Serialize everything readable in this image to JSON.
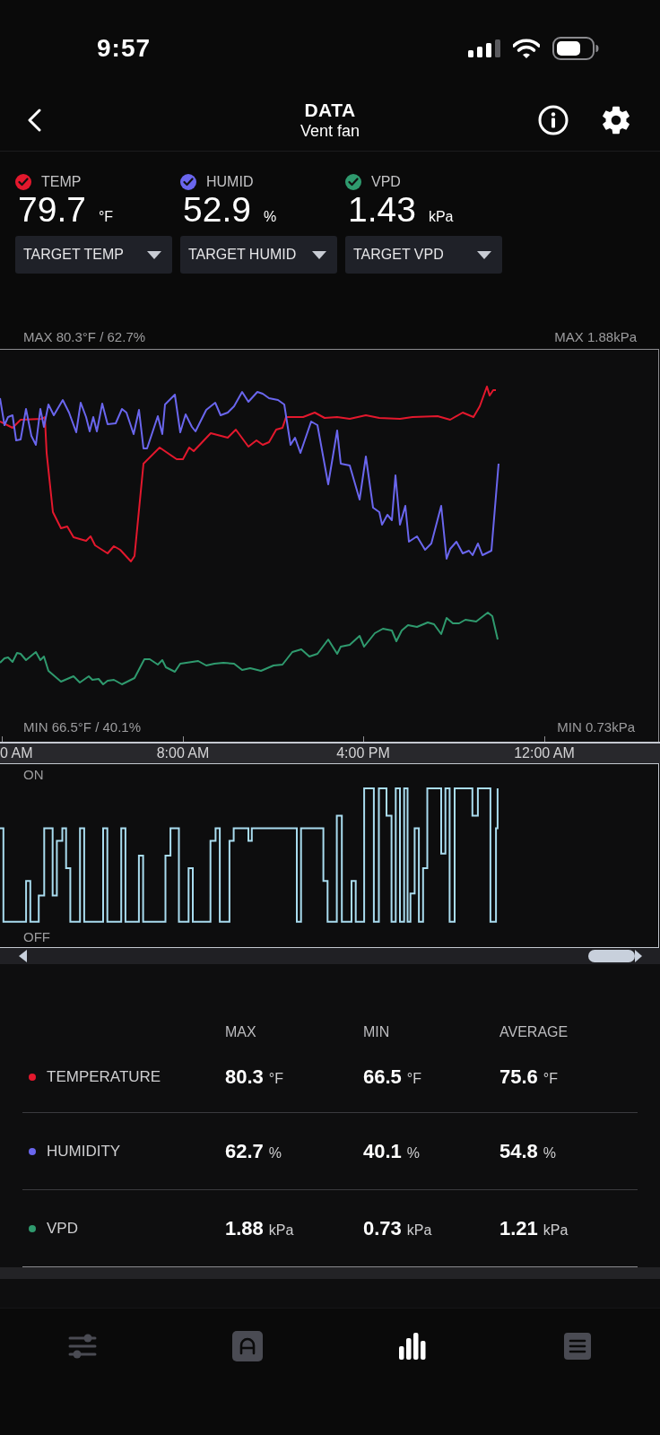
{
  "status_bar": {
    "time": "9:57"
  },
  "header": {
    "title": "DATA",
    "subtitle": "Vent fan"
  },
  "sensors": [
    {
      "label": "TEMP",
      "checked": true,
      "color": "#e3182d",
      "value": "79.7",
      "unit": "°F",
      "target": "TARGET TEMP"
    },
    {
      "label": "HUMID",
      "checked": true,
      "color": "#6a66ee",
      "value": "52.9",
      "unit": "%",
      "target": "TARGET HUMID"
    },
    {
      "label": "VPD",
      "checked": true,
      "color": "#2f9a6e",
      "value": "1.43",
      "unit": "kPa",
      "target": "TARGET VPD"
    }
  ],
  "chart": {
    "max_left": "MAX 80.3°F / 62.7%",
    "max_right": "MAX 1.88kPa",
    "min_left": "MIN 66.5°F / 40.1%",
    "min_right": "MIN 0.73kPa",
    "time_labels": [
      "0 AM",
      "8:00 AM",
      "4:00 PM",
      "12:00 AM"
    ]
  },
  "fan_chart": {
    "on_label": "ON",
    "off_label": "OFF"
  },
  "stats": {
    "columns": [
      "MAX",
      "MIN",
      "AVERAGE"
    ],
    "rows": [
      {
        "label": "TEMPERATURE",
        "color": "#e3182d",
        "cells": [
          {
            "value": "80.3",
            "unit": "°F"
          },
          {
            "value": "66.5",
            "unit": "°F"
          },
          {
            "value": "75.6",
            "unit": "°F"
          }
        ]
      },
      {
        "label": "HUMIDITY",
        "color": "#6a66ee",
        "cells": [
          {
            "value": "62.7",
            "unit": "%"
          },
          {
            "value": "40.1",
            "unit": "%"
          },
          {
            "value": "54.8",
            "unit": "%"
          }
        ]
      },
      {
        "label": "VPD",
        "color": "#2f9a6e",
        "cells": [
          {
            "value": "1.88",
            "unit": "kPa"
          },
          {
            "value": "0.73",
            "unit": "kPa"
          },
          {
            "value": "1.21",
            "unit": "kPa"
          }
        ]
      }
    ]
  },
  "bottom_nav": [
    {
      "kind": "sliders",
      "selected": false
    },
    {
      "kind": "arch",
      "selected": false
    },
    {
      "kind": "bars",
      "selected": true
    },
    {
      "kind": "list",
      "selected": false
    }
  ]
}
